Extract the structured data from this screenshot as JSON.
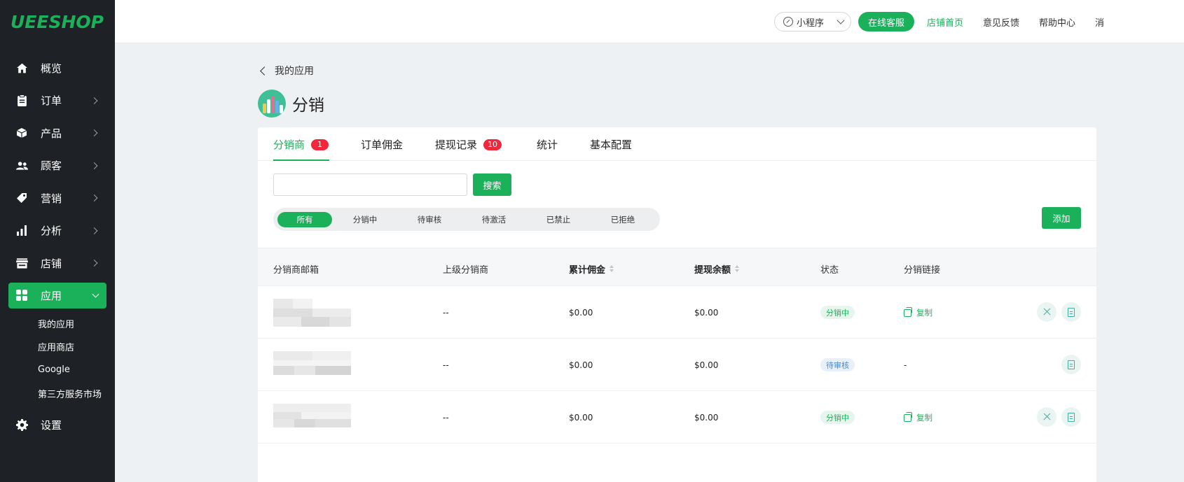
{
  "logo": "UEESHOP",
  "sidebar": {
    "items": [
      {
        "label": "概览",
        "icon": "home-icon"
      },
      {
        "label": "订单",
        "icon": "clipboard-icon"
      },
      {
        "label": "产品",
        "icon": "box-icon"
      },
      {
        "label": "顾客",
        "icon": "users-icon"
      },
      {
        "label": "营销",
        "icon": "tag-icon"
      },
      {
        "label": "分析",
        "icon": "bar-chart-icon"
      },
      {
        "label": "店铺",
        "icon": "store-icon"
      },
      {
        "label": "应用",
        "icon": "apps-icon"
      },
      {
        "label": "设置",
        "icon": "gear-icon"
      }
    ],
    "subitems": [
      "我的应用",
      "应用商店",
      "Google",
      "第三方服务市场"
    ]
  },
  "topbar": {
    "mini_program": "小程序",
    "online_service": "在线客服",
    "links": [
      "店铺首页",
      "意见反馈",
      "帮助中心",
      "消"
    ]
  },
  "breadcrumb": {
    "back_label": "我的应用"
  },
  "app": {
    "title": "分销"
  },
  "tabs": [
    {
      "label": "分销商",
      "badge": "1"
    },
    {
      "label": "订单佣金",
      "badge": ""
    },
    {
      "label": "提现记录",
      "badge": "10"
    },
    {
      "label": "统计",
      "badge": ""
    },
    {
      "label": "基本配置",
      "badge": ""
    }
  ],
  "search": {
    "value": "",
    "placeholder": "",
    "button": "搜索"
  },
  "filters": [
    "所有",
    "分销中",
    "待审核",
    "待激活",
    "已禁止",
    "已拒绝"
  ],
  "add_button": "添加",
  "table": {
    "headers": [
      "分销商邮箱",
      "上级分销商",
      "累计佣金",
      "提现余额",
      "状态",
      "分销链接"
    ],
    "rows": [
      {
        "parent": "--",
        "commission": "$0.00",
        "balance": "$0.00",
        "status": "分销中",
        "link": "复制"
      },
      {
        "parent": "--",
        "commission": "$0.00",
        "balance": "$0.00",
        "status": "待审核",
        "link": "-"
      },
      {
        "parent": "--",
        "commission": "$0.00",
        "balance": "$0.00",
        "status": "分销中",
        "link": "复制"
      }
    ]
  },
  "colors": {
    "accent": "#1bb15a",
    "sidebar_bg": "#1e2125",
    "badge_red": "#f0283c"
  }
}
